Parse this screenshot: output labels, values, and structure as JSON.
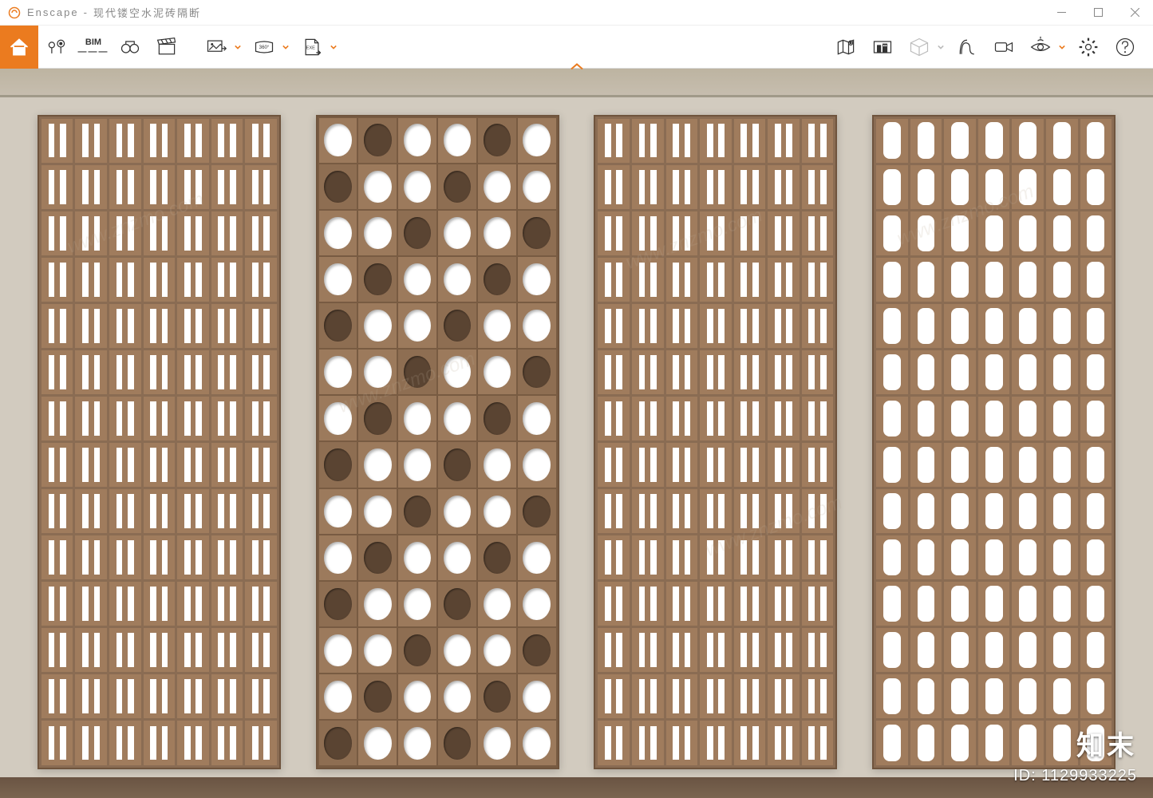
{
  "app": {
    "name": "Enscape",
    "document_title": "现代镂空水泥砖隔断",
    "title_separator": "-"
  },
  "toolbar": {
    "home": "home",
    "pin": "location-pin",
    "bim_label": "BIM",
    "bim_sub": "———",
    "binoculars": "binoculars",
    "clapper": "clapperboard",
    "export_image": "export-image",
    "pano_label": "360°",
    "exe_label": "EXE",
    "map": "map",
    "site_model": "site-model",
    "cube": "cube",
    "walkthrough": "path",
    "camera": "video-camera",
    "eye": "visibility",
    "settings": "settings",
    "help": "help"
  },
  "watermark": {
    "logo_text": "知末",
    "id_label": "ID: 1129933225",
    "diag_text": "www.znzmo.com"
  }
}
